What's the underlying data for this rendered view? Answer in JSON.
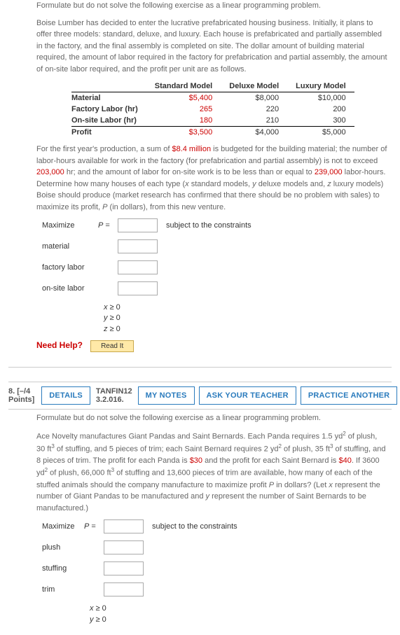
{
  "p1": {
    "intro": "Formulate but do not solve the following exercise as a linear programming problem.",
    "desc": "Boise Lumber has decided to enter the lucrative prefabricated housing business. Initially, it plans to offer three models: standard, deluxe, and luxury. Each house is prefabricated and partially assembled in the factory, and the final assembly is completed on site. The dollar amount of building material required, the amount of labor required in the factory for prefabrication and partial assembly, the amount of on-site labor required, and the profit per unit are as follows.",
    "table": {
      "h1": "Standard Model",
      "h2": "Deluxe Model",
      "h3": "Luxury Model",
      "r1": {
        "label": "Material",
        "c1": "$5,400",
        "c2": "$8,000",
        "c3": "$10,000"
      },
      "r2": {
        "label": "Factory Labor (hr)",
        "c1": "265",
        "c2": "220",
        "c3": "200"
      },
      "r3": {
        "label": "On-site Labor (hr)",
        "c1": "180",
        "c2": "210",
        "c3": "300"
      },
      "r4": {
        "label": "Profit",
        "c1": "$3,500",
        "c2": "$4,000",
        "c3": "$5,000"
      }
    },
    "para2_a": "For the first year's production, a sum of ",
    "para2_v1": "$8.4 million",
    "para2_b": " is budgeted for the building material; the number of labor-hours available for work in the factory (for prefabrication and partial assembly) is not to exceed ",
    "para2_v2": "203,000",
    "para2_c": " hr; and the amount of labor for on-site work is to be less than or equal to ",
    "para2_v3": "239,000",
    "para2_d": " labor-hours. Determine how many houses of each type (",
    "para2_e": " standard models, ",
    "para2_f": " deluxe models and, ",
    "para2_g": " luxury models) Boise should produce (market research has confirmed that there should be no problem with sales) to maximize its profit, ",
    "para2_h": " (in dollars), from this new venture.",
    "maximize": "Maximize",
    "Pvar": "P",
    "eq": " = ",
    "subject": "subject to the constraints",
    "lab_material": "material",
    "lab_factory": "factory labor",
    "lab_onsite": "on-site labor",
    "xge": "x ≥ 0",
    "yge": "y ≥ 0",
    "zge": "z ≥ 0",
    "need_help": "Need Help?",
    "readit": "Read It"
  },
  "q8": {
    "num": "8.",
    "points": "[–/4 Points]",
    "details": "DETAILS",
    "source": "TANFIN12 3.2.016.",
    "mynotes": "MY NOTES",
    "ask": "ASK YOUR TEACHER",
    "practice": "PRACTICE ANOTHER"
  },
  "p2": {
    "intro": "Formulate but do not solve the following exercise as a linear programming problem.",
    "t1": "Ace Novelty manufactures Giant Pandas and Saint Bernards. Each Panda requires 1.5 yd",
    "t2": " of plush, 30 ft",
    "t3": " of stuffing, and 5 pieces of trim; each Saint Bernard requires 2 yd",
    "t4": " of plush, 35 ft",
    "t5": " of stuffing, and 8 pieces of trim. The profit for each Panda is ",
    "v30": "$30",
    "t6": " and the profit for each Saint Bernard is ",
    "v40": "$40",
    "t7": ". If 3600 yd",
    "t8": " of plush, 66,000 ft",
    "t9": " of stuffing and 13,600 pieces of trim are available, how many of each of the stuffed animals should the company manufacture to maximize profit ",
    "t10": " in dollars? (Let ",
    "t11": " represent the number of Giant Pandas to be manufactured and ",
    "t12": " represent the number of Saint Bernards to be manufactured.)",
    "maximize": "Maximize",
    "Pvar": "P",
    "eq": " = ",
    "subject": "subject to the constraints",
    "lab_plush": "plush",
    "lab_stuffing": "stuffing",
    "lab_trim": "trim",
    "xge": "x ≥ 0",
    "yge": "y ≥ 0"
  }
}
